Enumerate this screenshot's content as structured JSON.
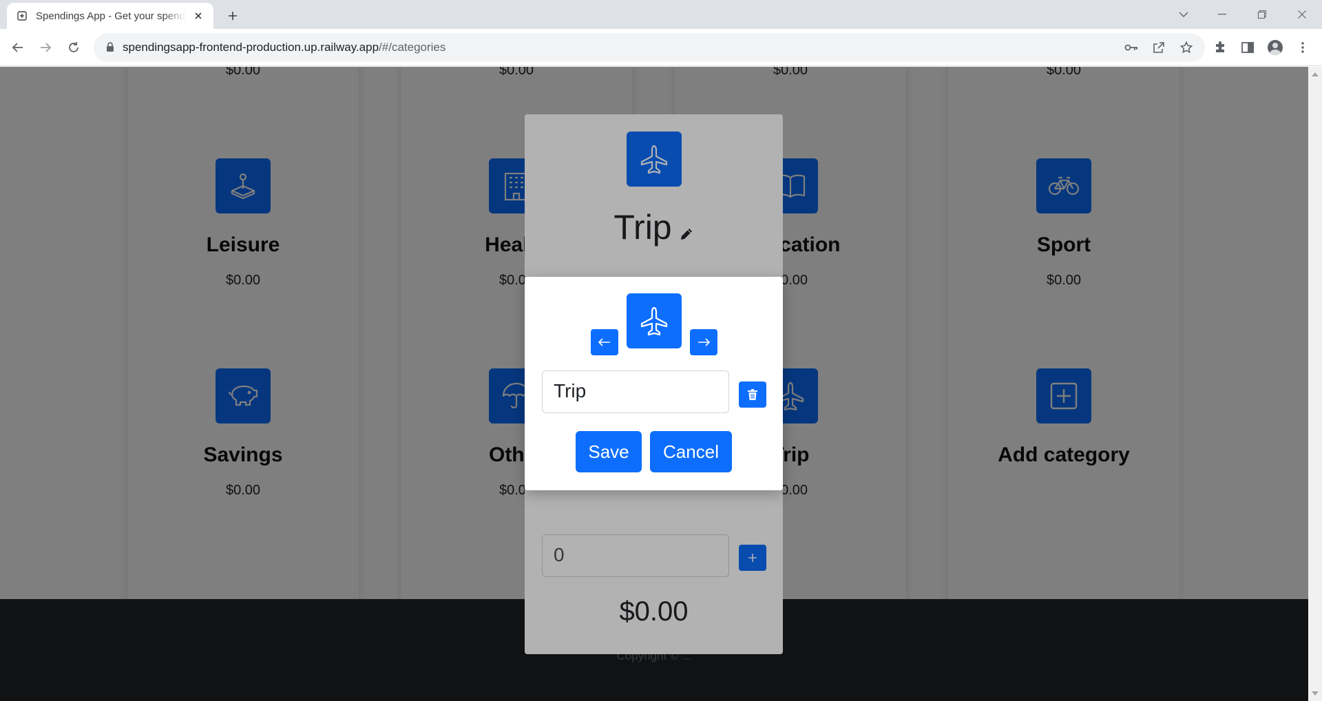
{
  "browser": {
    "tab_title": "Spendings App - Get your spendings",
    "url_host": "spendingsapp-frontend-production.up.railway.app",
    "url_path": "/#/categories"
  },
  "categories": [
    {
      "name": "",
      "amount": "$0.00",
      "icon": "unknown"
    },
    {
      "name": "",
      "amount": "$0.00",
      "icon": "unknown"
    },
    {
      "name": "",
      "amount": "$0.00",
      "icon": "unknown"
    },
    {
      "name": "",
      "amount": "$0.00",
      "icon": "unknown"
    },
    {
      "name": "Leisure",
      "amount": "$0.00",
      "icon": "joystick-icon"
    },
    {
      "name": "Health",
      "amount": "$0.00",
      "icon": "hospital-icon"
    },
    {
      "name": "Education",
      "amount": "$0.00",
      "icon": "book-icon"
    },
    {
      "name": "Sport",
      "amount": "$0.00",
      "icon": "bicycle-icon"
    },
    {
      "name": "Savings",
      "amount": "$0.00",
      "icon": "piggy-bank-icon"
    },
    {
      "name": "Other",
      "amount": "$0.00",
      "icon": "umbrella-icon"
    },
    {
      "name": "Trip",
      "amount": "$0.00",
      "icon": "airplane-icon"
    },
    {
      "name": "Add category",
      "amount": "",
      "icon": "plus-square-icon"
    }
  ],
  "footer": {
    "text": "Copyright © ..."
  },
  "modal": {
    "title": "Trip",
    "amount_input_value": "0",
    "total": "$0.00",
    "icon": "airplane-icon"
  },
  "edit_popup": {
    "name_input_value": "Trip",
    "save_label": "Save",
    "cancel_label": "Cancel",
    "icon": "airplane-icon"
  },
  "colors": {
    "primary": "#0d6efd",
    "footer_bg": "#212529"
  }
}
